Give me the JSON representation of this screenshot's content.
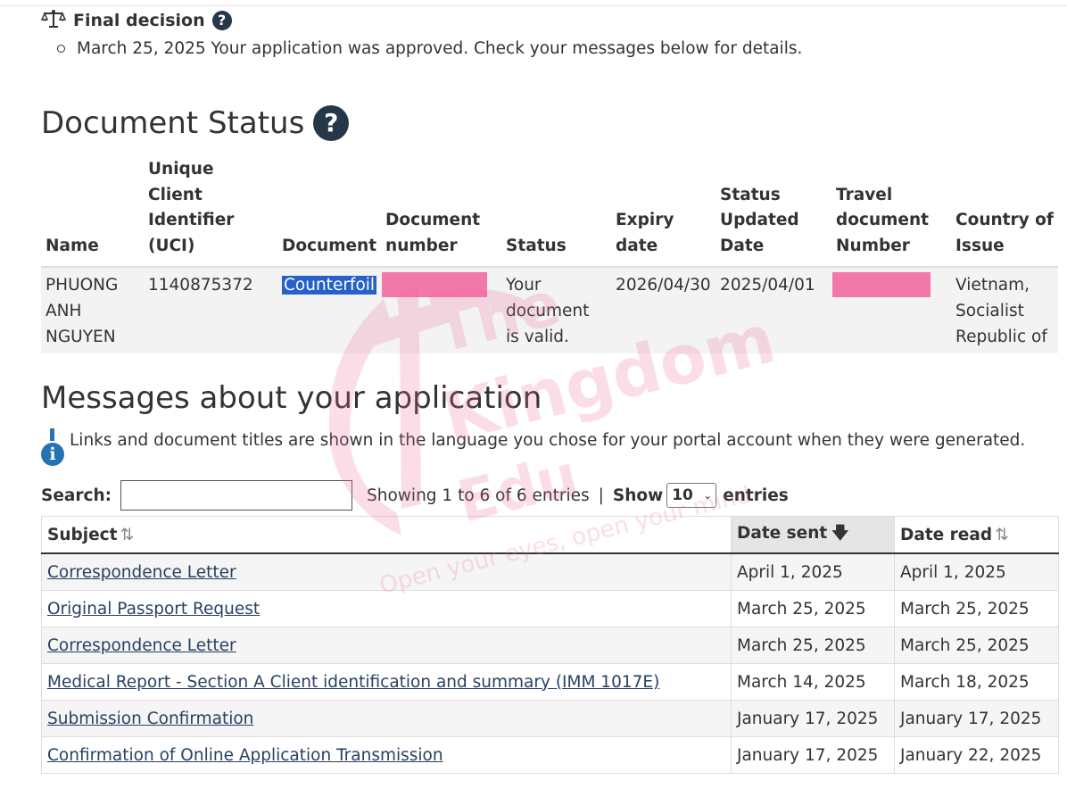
{
  "final_decision": {
    "title": "Final decision",
    "item": "March 25, 2025 Your application was approved. Check your messages below for details."
  },
  "document_status": {
    "heading": "Document Status",
    "headers": {
      "name": "Name",
      "uci": "Unique Client Identifier (UCI)",
      "document": "Document",
      "document_number": "Document number",
      "status": "Status",
      "expiry": "Expiry date",
      "status_updated": "Status Updated Date",
      "travel_doc": "Travel document Number",
      "country": "Country of Issue"
    },
    "row": {
      "name": "PHUONG ANH NGUYEN",
      "uci": "1140875372",
      "document": "Counterfoil",
      "status": "Your document is valid.",
      "expiry": "2026/04/30",
      "status_updated": "2025/04/01",
      "country": "Vietnam, Socialist Republic of"
    }
  },
  "messages": {
    "heading": "Messages about your application",
    "info_text": "Links and document titles are shown in the language you chose for your portal account when they were generated.",
    "search_label": "Search:",
    "search_value": "",
    "showing_text": "Showing 1 to 6 of 6 entries",
    "show_label": "Show",
    "page_length": "10",
    "entries_label": "entries",
    "headers": {
      "subject": "Subject",
      "date_sent": "Date sent",
      "date_read": "Date read"
    },
    "rows": [
      {
        "subject": "Correspondence Letter",
        "date_sent": "April 1, 2025",
        "date_read": "April 1, 2025"
      },
      {
        "subject": "Original Passport Request",
        "date_sent": "March 25, 2025",
        "date_read": "March 25, 2025"
      },
      {
        "subject": "Correspondence Letter",
        "date_sent": "March 25, 2025",
        "date_read": "March 25, 2025"
      },
      {
        "subject": "Medical Report - Section A Client identification and summary (IMM 1017E)",
        "date_sent": "March 14, 2025",
        "date_read": "March 18, 2025"
      },
      {
        "subject": "Submission Confirmation",
        "date_sent": "January 17, 2025",
        "date_read": "January 17, 2025"
      },
      {
        "subject": "Confirmation of Online Application Transmission",
        "date_sent": "January 17, 2025",
        "date_read": "January 22, 2025"
      }
    ]
  },
  "watermark": {
    "line1": "The",
    "line2": "Kingdom",
    "line3": "Edu",
    "tagline": "Open your eyes, open your mind",
    "color": "#f06a9c"
  },
  "colors": {
    "help_icon": "#26374a",
    "link": "#284162",
    "highlight": "#2561c7",
    "redaction": "#f277ab",
    "info_icon": "#2572b4"
  }
}
